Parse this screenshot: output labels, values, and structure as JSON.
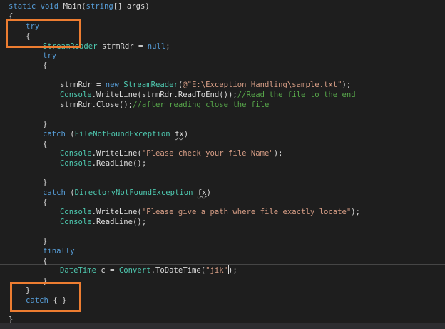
{
  "code": {
    "l0_kw1": "static",
    "l0_kw2": "void",
    "l0_rest": " Main(",
    "l0_kw3": "string",
    "l0_rest2": "[] args)",
    "l1": "{",
    "l2_kw": "try",
    "l3": "{",
    "l4_ty": "StreamReader",
    "l4_rest": " strmRdr = ",
    "l4_kw": "null",
    "l4_end": ";",
    "l5_kw": "try",
    "l6": "{",
    "l7_a": "strmRdr = ",
    "l7_kw": "new",
    "l7_ty": " StreamReader",
    "l7_b": "(",
    "l7_str": "@\"E:\\Exception Handling\\sample.txt\"",
    "l7_c": ");",
    "l8_ty": "Console",
    "l8_a": ".WriteLine(strmRdr.ReadToEnd());",
    "l8_cm": "//Read the file to the end",
    "l9_a": "strmRdr.Close();",
    "l9_cm": "//after reading close the file",
    "l10": "}",
    "l11_kw": "catch",
    "l11_a": " (",
    "l11_ty": "FileNotFoundException",
    "l11_b": " ",
    "l11_sq": "fx",
    "l11_c": ")",
    "l12": "{",
    "l13_ty": "Console",
    "l13_a": ".WriteLine(",
    "l13_str": "\"Please check your file Name\"",
    "l13_b": ");",
    "l14_ty": "Console",
    "l14_a": ".ReadLine();",
    "l15": "}",
    "l16_kw": "catch",
    "l16_a": " (",
    "l16_ty": "DirectoryNotFoundException",
    "l16_b": " ",
    "l16_sq": "fx",
    "l16_c": ")",
    "l17": "{",
    "l18_ty": "Console",
    "l18_a": ".WriteLine(",
    "l18_str": "\"Please give a path where file exactly locate\"",
    "l18_b": ");",
    "l19_ty": "Console",
    "l19_a": ".ReadLine();",
    "l20": "}",
    "l21_kw": "finally",
    "l22": "{",
    "l23_ty": "DateTime",
    "l23_a": " c = ",
    "l23_ty2": "Convert",
    "l23_b": ".ToDateTime(",
    "l23_str": "\"jik\"",
    "l23_c": ");",
    "l24": "}",
    "l25": "}",
    "l26_kw": "catch",
    "l26_a": " { }",
    "l27": "}"
  },
  "colors": {
    "background": "#1e1e1e",
    "keyword": "#569cd6",
    "type": "#4ec9b0",
    "string": "#d69d85",
    "comment": "#57a64a",
    "highlight_box": "#ed7d31"
  }
}
